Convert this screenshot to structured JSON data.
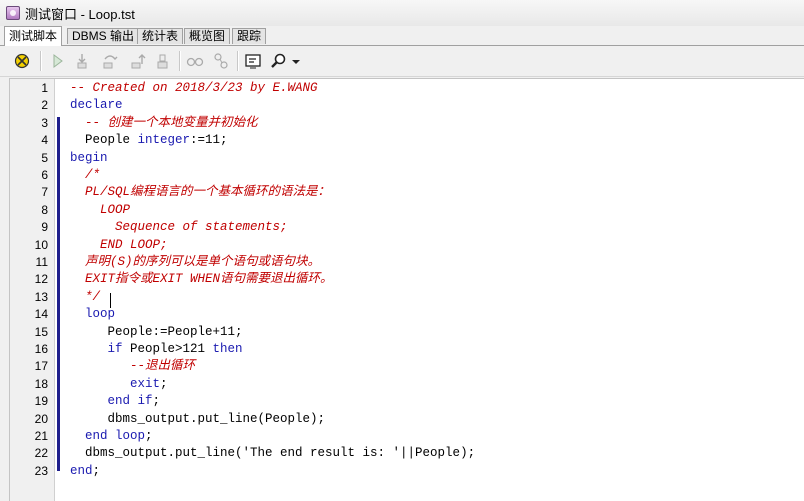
{
  "window": {
    "title": "测试窗口 - Loop.tst"
  },
  "tabs": [
    {
      "label": "测试脚本",
      "active": true
    },
    {
      "label": "DBMS 输出",
      "active": false
    },
    {
      "label": "统计表",
      "active": false
    },
    {
      "label": "概览图",
      "active": false
    },
    {
      "label": "跟踪",
      "active": false
    }
  ],
  "toolbar": {
    "icons": [
      "execute-icon",
      "run-icon",
      "step-into-icon",
      "step-over-icon",
      "step-out-icon",
      "run-to-exception-icon",
      "toggle-breakpoint-icon",
      "evaluate-icon",
      "output-window-icon",
      "find-icon",
      "dropdown-arrow-icon"
    ]
  },
  "colors": {
    "keyword": "#1a1ab0",
    "comment": "#c00000",
    "fold_bar": "#1f1f8c"
  },
  "editor": {
    "line_numbers": [
      "1",
      "2",
      "3",
      "4",
      "5",
      "6",
      "7",
      "8",
      "9",
      "10",
      "11",
      "12",
      "13",
      "14",
      "15",
      "16",
      "17",
      "18",
      "19",
      "20",
      "21",
      "22",
      "23"
    ],
    "lines": [
      [
        {
          "t": "-- Created on 2018/3/23 by E.WANG",
          "c": "cm"
        }
      ],
      [
        {
          "t": "declare",
          "c": "kw"
        }
      ],
      [
        {
          "t": "  -- 创建一个本地变量并初始化",
          "c": "cm"
        }
      ],
      [
        {
          "t": "  People ",
          "c": "tx"
        },
        {
          "t": "integer",
          "c": "kw"
        },
        {
          "t": ":=11;",
          "c": "tx"
        }
      ],
      [
        {
          "t": "begin",
          "c": "kw"
        }
      ],
      [
        {
          "t": "  /*",
          "c": "cm"
        }
      ],
      [
        {
          "t": "  PL/SQL编程语言的一个基本循环的语法是：",
          "c": "cm"
        }
      ],
      [
        {
          "t": "    LOOP",
          "c": "cm"
        }
      ],
      [
        {
          "t": "      Sequence of statements;",
          "c": "cm"
        }
      ],
      [
        {
          "t": "    END LOOP;",
          "c": "cm"
        }
      ],
      [
        {
          "t": "  声明(S)的序列可以是单个语句或语句块。",
          "c": "cm"
        }
      ],
      [
        {
          "t": "  EXIT指令或EXIT WHEN语句需要退出循环。",
          "c": "cm"
        }
      ],
      [
        {
          "t": "  */",
          "c": "cm"
        }
      ],
      [
        {
          "t": "  loop",
          "c": "kw"
        }
      ],
      [
        {
          "t": "     People:=People+11;",
          "c": "tx"
        }
      ],
      [
        {
          "t": "     ",
          "c": "tx"
        },
        {
          "t": "if",
          "c": "kw"
        },
        {
          "t": " People>121 ",
          "c": "tx"
        },
        {
          "t": "then",
          "c": "kw"
        }
      ],
      [
        {
          "t": "        --退出循环",
          "c": "cm"
        }
      ],
      [
        {
          "t": "        ",
          "c": "tx"
        },
        {
          "t": "exit",
          "c": "kw"
        },
        {
          "t": ";",
          "c": "tx"
        }
      ],
      [
        {
          "t": "     ",
          "c": "tx"
        },
        {
          "t": "end if",
          "c": "kw"
        },
        {
          "t": ";",
          "c": "tx"
        }
      ],
      [
        {
          "t": "     dbms_output.put_line(People);",
          "c": "tx"
        }
      ],
      [
        {
          "t": "  ",
          "c": "tx"
        },
        {
          "t": "end loop",
          "c": "kw"
        },
        {
          "t": ";",
          "c": "tx"
        }
      ],
      [
        {
          "t": "  dbms_output.put_line('The end result is: '||People);",
          "c": "tx"
        }
      ],
      [
        {
          "t": "end",
          "c": "kw"
        },
        {
          "t": ";",
          "c": "tx"
        }
      ]
    ]
  }
}
